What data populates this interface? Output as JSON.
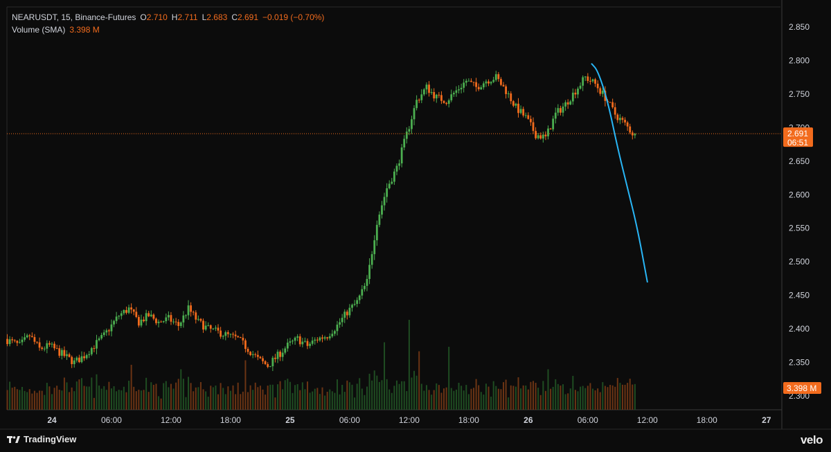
{
  "legend": {
    "symbol": "NEARUSDT, 15, Binance-Futures",
    "o_label": "O",
    "o_value": "2.710",
    "h_label": "H",
    "h_value": "2.711",
    "l_label": "L",
    "l_value": "2.683",
    "c_label": "C",
    "c_value": "2.691",
    "change": "−0.019 (−0.70%)",
    "volume_label": "Volume (SMA)",
    "volume_value": "3.398 M"
  },
  "branding": {
    "tradingview": "TradingView",
    "velo": "velo"
  },
  "colors": {
    "background": "#0c0c0c",
    "up": "#4caf50",
    "down": "#f26b1d",
    "last_price": "#f26b1d",
    "projection": "#29b6f6",
    "axis_text": "#d1d4dc"
  },
  "chart_data": {
    "type": "candlestick",
    "symbol": "NEARUSDT",
    "interval": "15",
    "exchange": "Binance-Futures",
    "y_axis": {
      "ticks": [
        "2.850",
        "2.800",
        "2.750",
        "2.700",
        "2.650",
        "2.600",
        "2.550",
        "2.500",
        "2.450",
        "2.400",
        "2.350",
        "2.300"
      ],
      "range": [
        2.28,
        2.87
      ]
    },
    "x_axis": {
      "ticks": [
        "24",
        "06:00",
        "12:00",
        "18:00",
        "25",
        "06:00",
        "12:00",
        "18:00",
        "26",
        "06:00",
        "12:00",
        "18:00",
        "27"
      ],
      "range_hours": [
        -4.5,
        74.5
      ]
    },
    "last_price": {
      "value": 2.691,
      "label": "2.691",
      "countdown": "06:51"
    },
    "last_volume_label": "3.398 M",
    "price_path": [
      {
        "h": -4.5,
        "p": 2.385
      },
      {
        "h": -3,
        "p": 2.375
      },
      {
        "h": -2,
        "p": 2.39
      },
      {
        "h": -1,
        "p": 2.37
      },
      {
        "h": 0,
        "p": 2.375
      },
      {
        "h": 1.5,
        "p": 2.36
      },
      {
        "h": 2.5,
        "p": 2.35
      },
      {
        "h": 3.5,
        "p": 2.36
      },
      {
        "h": 4.5,
        "p": 2.375
      },
      {
        "h": 5.5,
        "p": 2.39
      },
      {
        "h": 7,
        "p": 2.42
      },
      {
        "h": 8,
        "p": 2.43
      },
      {
        "h": 9,
        "p": 2.41
      },
      {
        "h": 10,
        "p": 2.42
      },
      {
        "h": 11,
        "p": 2.41
      },
      {
        "h": 12,
        "p": 2.415
      },
      {
        "h": 13,
        "p": 2.405
      },
      {
        "h": 14,
        "p": 2.43
      },
      {
        "h": 15,
        "p": 2.41
      },
      {
        "h": 16,
        "p": 2.4
      },
      {
        "h": 17,
        "p": 2.395
      },
      {
        "h": 18,
        "p": 2.39
      },
      {
        "h": 19,
        "p": 2.385
      },
      {
        "h": 20,
        "p": 2.37
      },
      {
        "h": 21,
        "p": 2.355
      },
      {
        "h": 22,
        "p": 2.345
      },
      {
        "h": 23,
        "p": 2.36
      },
      {
        "h": 24,
        "p": 2.375
      },
      {
        "h": 25,
        "p": 2.385
      },
      {
        "h": 26,
        "p": 2.375
      },
      {
        "h": 27,
        "p": 2.385
      },
      {
        "h": 28,
        "p": 2.39
      },
      {
        "h": 29,
        "p": 2.405
      },
      {
        "h": 30,
        "p": 2.425
      },
      {
        "h": 31,
        "p": 2.44
      },
      {
        "h": 32,
        "p": 2.47
      },
      {
        "h": 33,
        "p": 2.56
      },
      {
        "h": 34,
        "p": 2.61
      },
      {
        "h": 35,
        "p": 2.64
      },
      {
        "h": 36,
        "p": 2.69
      },
      {
        "h": 37,
        "p": 2.74
      },
      {
        "h": 38,
        "p": 2.76
      },
      {
        "h": 39,
        "p": 2.745
      },
      {
        "h": 40,
        "p": 2.74
      },
      {
        "h": 41,
        "p": 2.755
      },
      {
        "h": 42,
        "p": 2.77
      },
      {
        "h": 43,
        "p": 2.76
      },
      {
        "h": 44,
        "p": 2.77
      },
      {
        "h": 45,
        "p": 2.775
      },
      {
        "h": 46,
        "p": 2.755
      },
      {
        "h": 47,
        "p": 2.73
      },
      {
        "h": 48,
        "p": 2.715
      },
      {
        "h": 49,
        "p": 2.69
      },
      {
        "h": 50,
        "p": 2.685
      },
      {
        "h": 51,
        "p": 2.72
      },
      {
        "h": 52,
        "p": 2.735
      },
      {
        "h": 53,
        "p": 2.755
      },
      {
        "h": 54,
        "p": 2.775
      },
      {
        "h": 55,
        "p": 2.765
      },
      {
        "h": 56,
        "p": 2.745
      },
      {
        "h": 57,
        "p": 2.72
      },
      {
        "h": 58,
        "p": 2.705
      },
      {
        "h": 58.8,
        "p": 2.691
      }
    ],
    "volume_spikes": [
      {
        "h": 8,
        "v": 0.5
      },
      {
        "h": 13,
        "v": 0.45
      },
      {
        "h": 19.5,
        "v": 0.55
      },
      {
        "h": 33.5,
        "v": 0.75
      },
      {
        "h": 36,
        "v": 1.0
      },
      {
        "h": 37,
        "v": 0.65
      },
      {
        "h": 40,
        "v": 0.7
      },
      {
        "h": 50,
        "v": 0.45
      }
    ],
    "projection": [
      {
        "h": 54.4,
        "p": 2.795
      },
      {
        "h": 55,
        "p": 2.785
      },
      {
        "h": 56,
        "p": 2.74
      },
      {
        "h": 57,
        "p": 2.67
      },
      {
        "h": 58,
        "p": 2.61
      },
      {
        "h": 59,
        "p": 2.55
      },
      {
        "h": 60,
        "p": 2.47
      }
    ]
  }
}
